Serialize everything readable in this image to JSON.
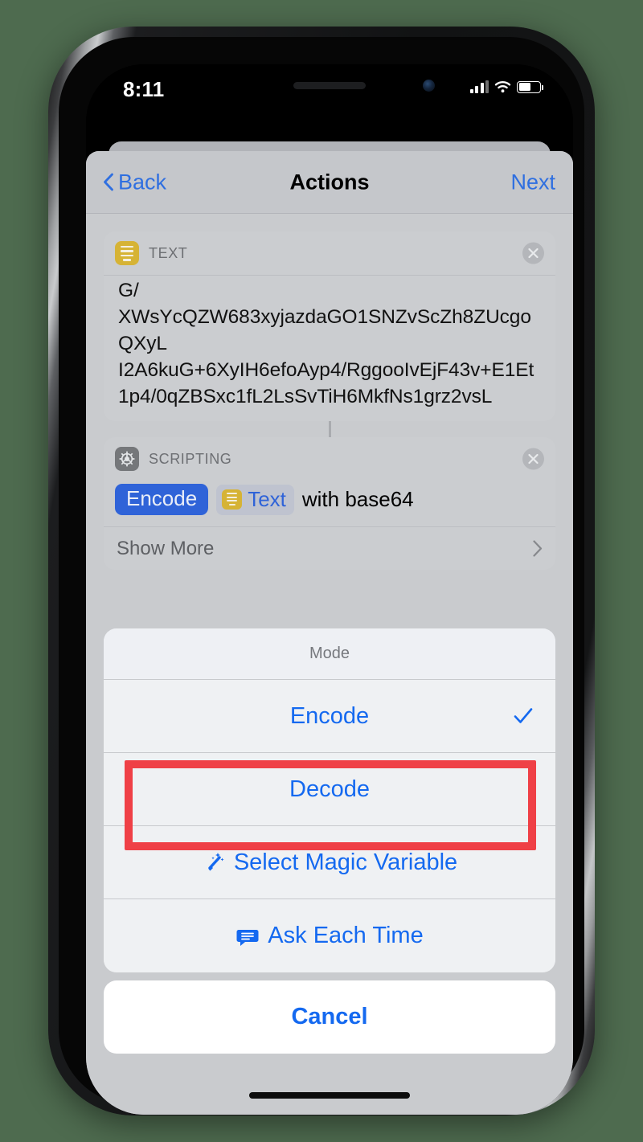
{
  "statusbar": {
    "time": "8:11",
    "signal_icon": "cellular-signal-icon",
    "wifi_icon": "wifi-icon",
    "battery_icon": "battery-icon"
  },
  "navbar": {
    "back_label": "Back",
    "title": "Actions",
    "next_label": "Next"
  },
  "blocks": [
    {
      "type": "text",
      "header_label": "TEXT",
      "icon": "text-action-icon",
      "body": "G/\nXWsYcQZW683xyjazdaGO1SNZvScZh8ZUcgoQXyL\nI2A6kuG+6XyIH6efoAyp4/RggooIvEjF43v+E1Et1p4/0qZBSxc1fL2LsSvTiH6MkfNs1grz2vsL"
    },
    {
      "type": "scripting",
      "header_label": "SCRIPTING",
      "icon": "gear-action-icon",
      "mode_pill": "Encode",
      "variable_token": "Text",
      "tail_text": "with base64",
      "show_more_label": "Show More"
    }
  ],
  "action_sheet": {
    "title": "Mode",
    "items": [
      {
        "label": "Encode",
        "selected": true,
        "icon": null
      },
      {
        "label": "Decode",
        "selected": false,
        "icon": null
      },
      {
        "label": "Select Magic Variable",
        "selected": false,
        "icon": "magic-wand-icon"
      },
      {
        "label": "Ask Each Time",
        "selected": false,
        "icon": "speech-bubble-icon"
      }
    ],
    "cancel_label": "Cancel"
  },
  "annotation": {
    "highlight_target": "Decode",
    "highlight_color": "#ef4046"
  },
  "colors": {
    "background": "#4e6b4f",
    "accent_blue": "#1469f0",
    "pill_blue": "#2f63d8",
    "text_icon_yellow": "#d6b335",
    "sheet_gray": "#c9cbce"
  }
}
